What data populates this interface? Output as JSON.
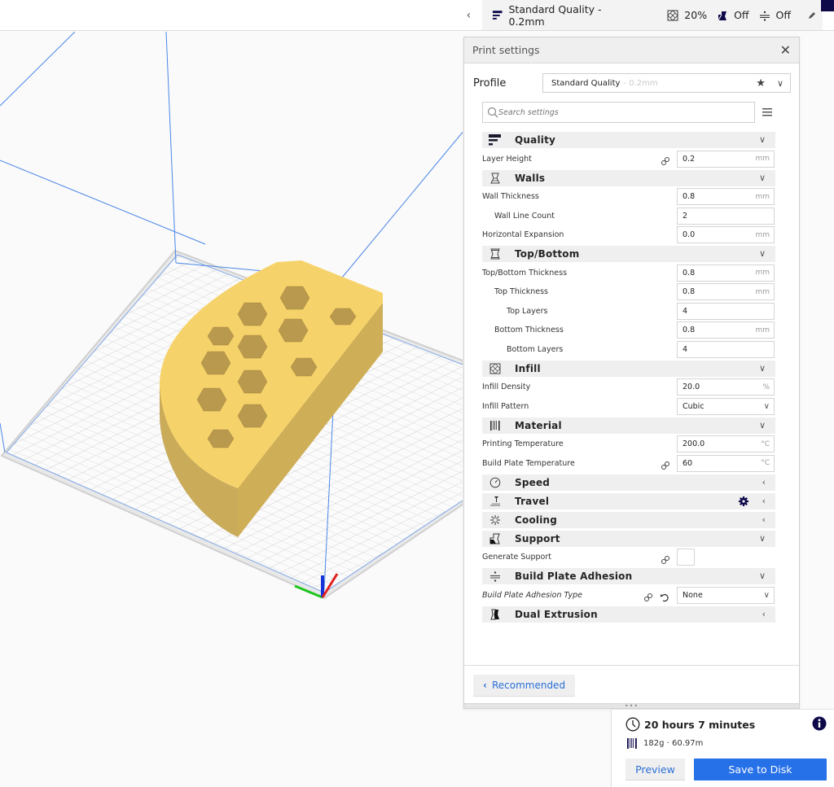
{
  "topbar": {
    "collapse_icon": "chevron-left-icon",
    "profile_label": "Standard Quality - 0.2mm",
    "infill_label": "20%",
    "support_label": "Off",
    "adhesion_label": "Off",
    "edit_icon": "pencil-icon"
  },
  "print_settings": {
    "title": "Print settings",
    "close_icon": "close-icon",
    "profile": {
      "label": "Profile",
      "selected_name": "Standard Quality",
      "selected_suffix": "- 0.2mm"
    },
    "search": {
      "placeholder": "Search settings",
      "value": ""
    },
    "categories": [
      {
        "name": "quality",
        "label": "Quality",
        "icon": "quality-icon",
        "expanded": true,
        "settings": [
          {
            "label": "Layer Height",
            "value": "0.2",
            "unit": "mm",
            "linked": true
          }
        ]
      },
      {
        "name": "walls",
        "label": "Walls",
        "icon": "walls-icon",
        "expanded": true,
        "settings": [
          {
            "label": "Wall Thickness",
            "value": "0.8",
            "unit": "mm"
          },
          {
            "label": "Wall Line Count",
            "value": "2",
            "unit": ""
          },
          {
            "label": "Horizontal Expansion",
            "value": "0.0",
            "unit": "mm"
          }
        ]
      },
      {
        "name": "top-bottom",
        "label": "Top/Bottom",
        "icon": "top-bottom-icon",
        "expanded": true,
        "settings": [
          {
            "label": "Top/Bottom Thickness",
            "value": "0.8",
            "unit": "mm"
          },
          {
            "label": "Top Thickness",
            "value": "0.8",
            "unit": "mm"
          },
          {
            "label": "Top Layers",
            "value": "4",
            "unit": ""
          },
          {
            "label": "Bottom Thickness",
            "value": "0.8",
            "unit": "mm"
          },
          {
            "label": "Bottom Layers",
            "value": "4",
            "unit": ""
          }
        ]
      },
      {
        "name": "infill",
        "label": "Infill",
        "icon": "infill-icon",
        "expanded": true,
        "settings": [
          {
            "label": "Infill Density",
            "value": "20.0",
            "unit": "%"
          },
          {
            "label": "Infill Pattern",
            "value": "Cubic",
            "type": "dropdown"
          }
        ]
      },
      {
        "name": "material",
        "label": "Material",
        "icon": "material-icon",
        "expanded": true,
        "settings": [
          {
            "label": "Printing Temperature",
            "value": "200.0",
            "unit": "°C"
          },
          {
            "label": "Build Plate Temperature",
            "value": "60",
            "unit": "°C",
            "linked": true
          }
        ]
      },
      {
        "name": "speed",
        "label": "Speed",
        "icon": "speed-icon",
        "expanded": false
      },
      {
        "name": "travel",
        "label": "Travel",
        "icon": "travel-icon",
        "expanded": false,
        "has_gear": true
      },
      {
        "name": "cooling",
        "label": "Cooling",
        "icon": "cooling-icon",
        "expanded": false
      },
      {
        "name": "support",
        "label": "Support",
        "icon": "support-icon",
        "expanded": true,
        "settings": [
          {
            "label": "Generate Support",
            "value": false,
            "type": "checkbox",
            "linked": true
          }
        ]
      },
      {
        "name": "build-plate-adhesion",
        "label": "Build Plate Adhesion",
        "icon": "adhesion-icon",
        "expanded": true,
        "settings": [
          {
            "label": "Build Plate Adhesion Type",
            "value": "None",
            "type": "dropdown",
            "linked": true,
            "resettable": true
          }
        ]
      },
      {
        "name": "dual-extrusion",
        "label": "Dual Extrusion",
        "icon": "dual-extrusion-icon",
        "expanded": false
      }
    ],
    "recommended_label": "Recommended"
  },
  "action_panel": {
    "print_time": "20 hours 7 minutes",
    "material_usage": "182g · 60.97m",
    "preview_label": "Preview",
    "save_label": "Save to Disk"
  },
  "colors": {
    "accent": "#2670e8",
    "link_blue": "#2a6fd6",
    "model_yellow": "#f6d36a",
    "build_volume_line": "#4a86e8"
  }
}
